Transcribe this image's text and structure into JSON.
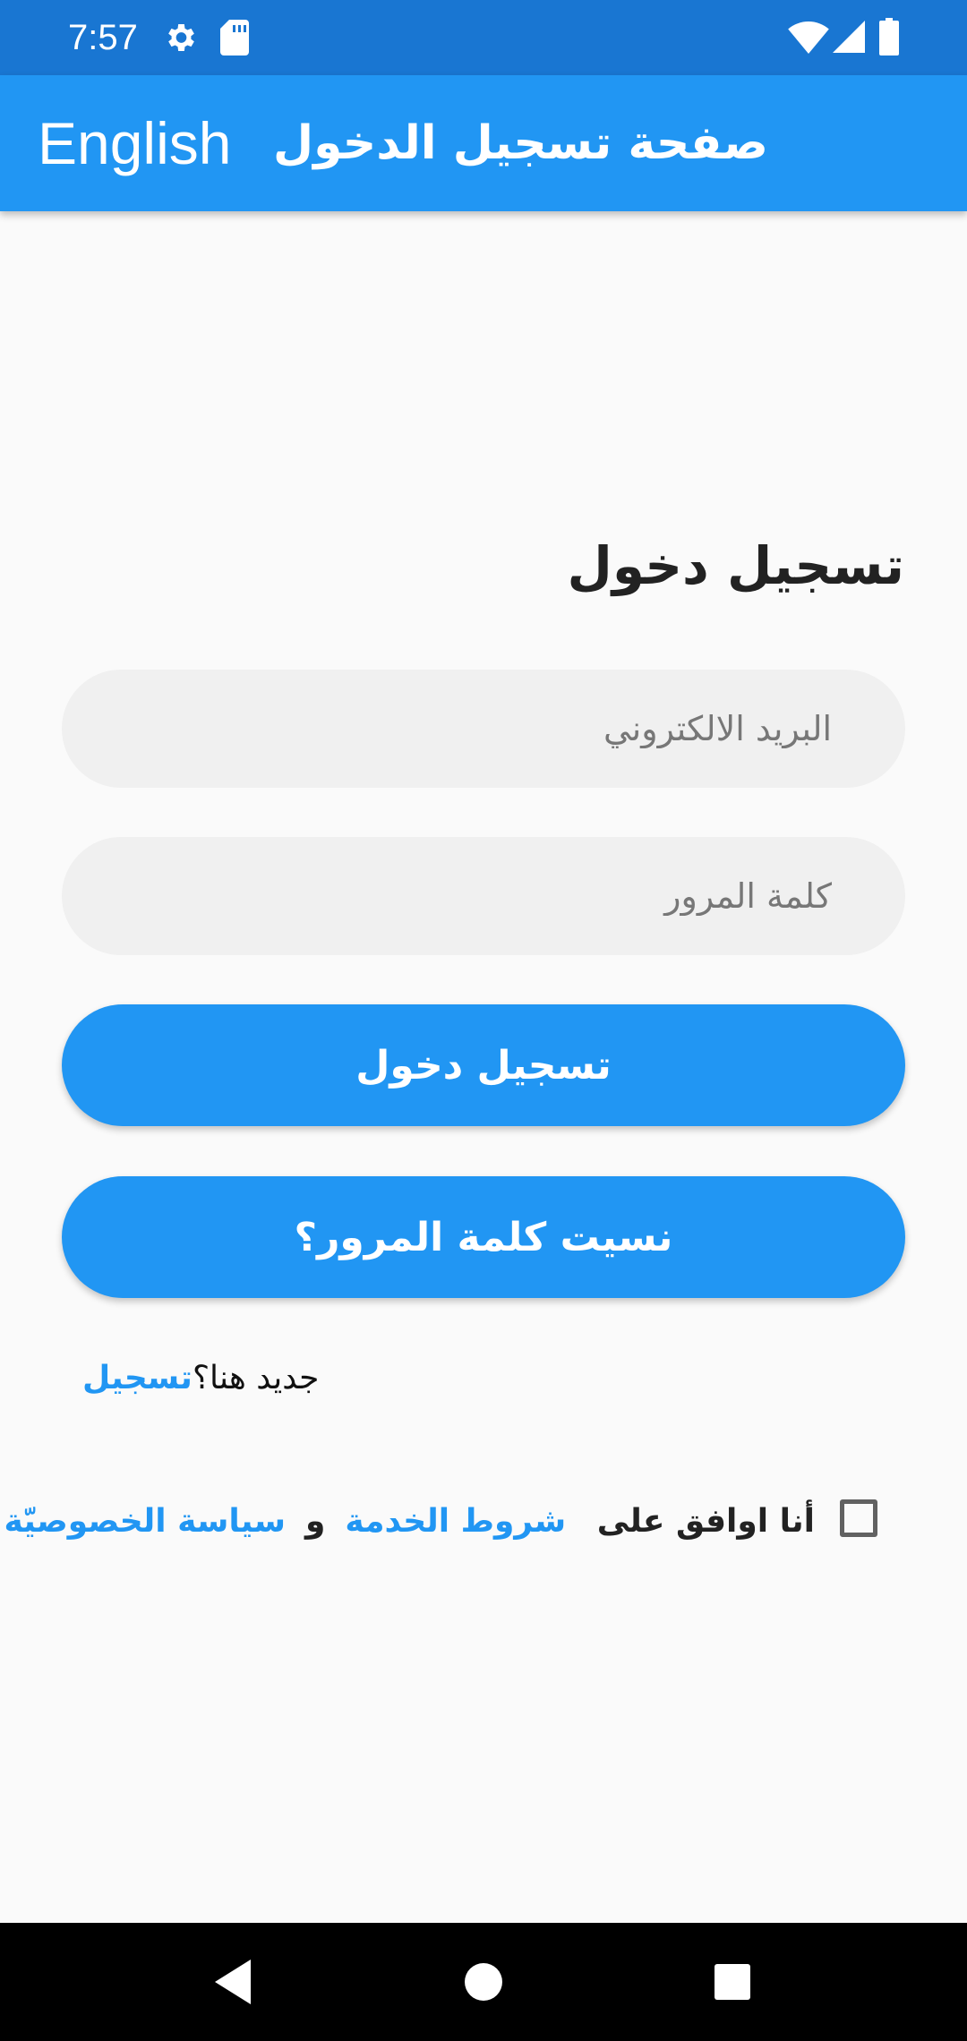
{
  "status_bar": {
    "time": "7:57",
    "icons": [
      "settings-gear-icon",
      "sd-card-icon",
      "wifi-icon",
      "cellular-signal-icon",
      "battery-icon"
    ]
  },
  "app_bar": {
    "language_toggle": "English",
    "title": "صفحة تسجيل الدخول"
  },
  "login_form": {
    "heading": "تسجيل دخول",
    "email_placeholder": "البريد الالكتروني",
    "email_value": "",
    "password_placeholder": "كلمة المرور",
    "password_value": "",
    "login_button": "تسجيل دخول",
    "forgot_password_button": "نسيت كلمة المرور؟"
  },
  "signup": {
    "prompt": "جديد هنا؟",
    "link": "تسجيل"
  },
  "agreement": {
    "checked": false,
    "prefix": "أنا اوافق على",
    "terms_link": "شروط الخدمة",
    "and": "و",
    "privacy_link": "سياسة الخصوصيّة"
  },
  "nav_bar": {
    "icons": [
      "back-icon",
      "home-icon",
      "recents-icon"
    ]
  },
  "colors": {
    "status_bar": "#1976d2",
    "app_bar": "#2196f3",
    "accent": "#2196f3",
    "background": "#fafafa",
    "input_fill": "#f0f0f0"
  }
}
